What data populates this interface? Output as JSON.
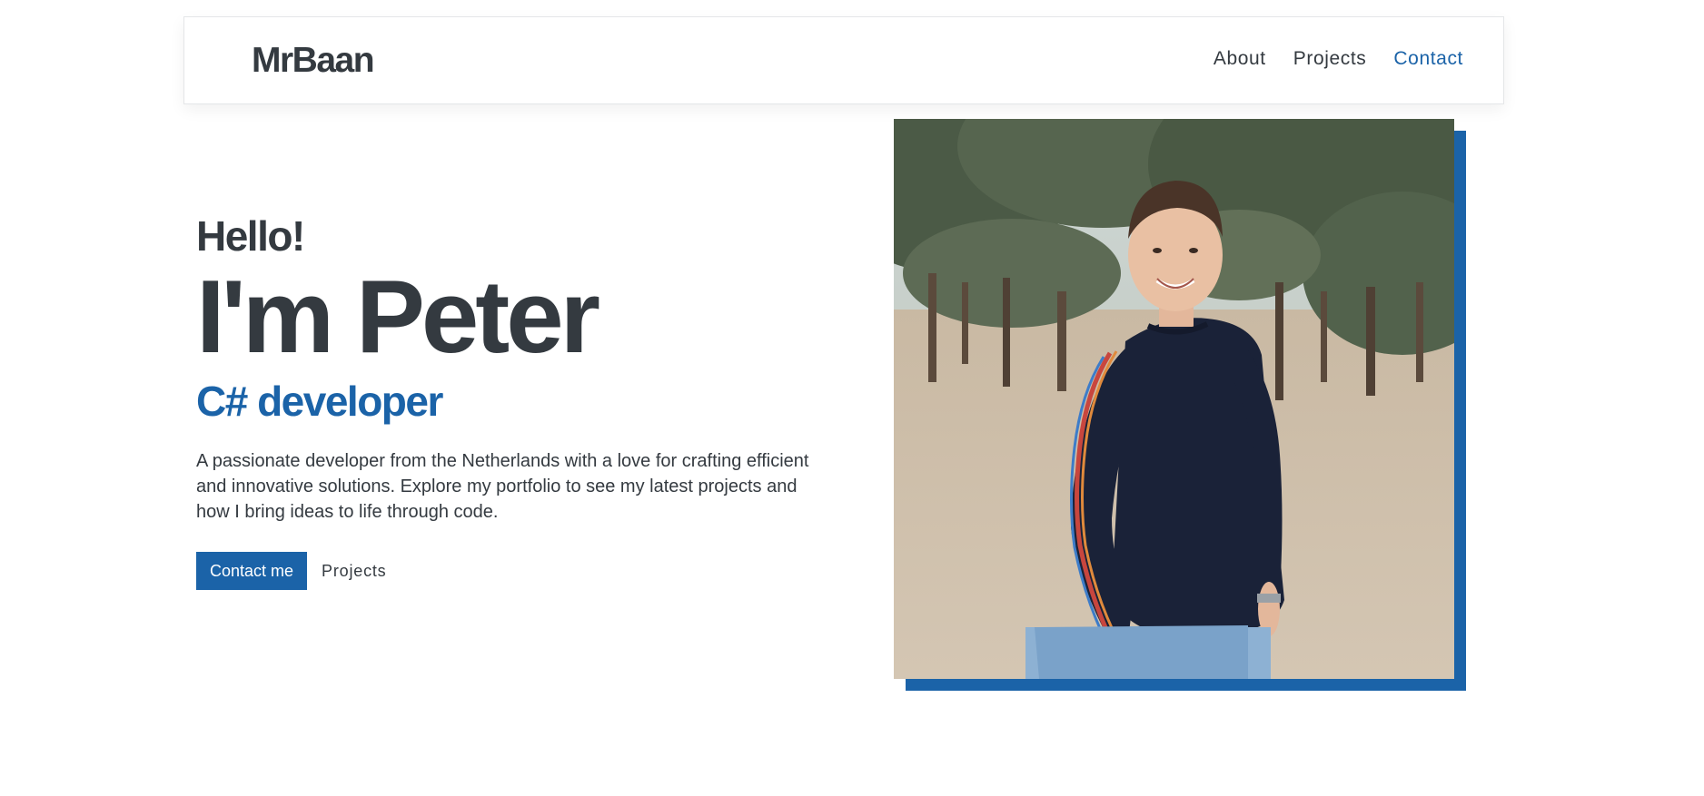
{
  "nav": {
    "brand": "MrBaan",
    "links": [
      {
        "label": "About"
      },
      {
        "label": "Projects"
      },
      {
        "label": "Contact"
      }
    ]
  },
  "hero": {
    "greeting": "Hello!",
    "headline": "I'm Peter",
    "role": "C# developer",
    "intro": "A passionate developer from the Netherlands with a love for crafting efficient and innovative solutions. Explore my portfolio to see my latest projects and how I bring ideas to life through code.",
    "primary_button": "Contact me",
    "secondary_button": "Projects"
  },
  "colors": {
    "accent": "#1b63a8",
    "text": "#343a40"
  },
  "photo": {
    "subject": "portrait"
  }
}
